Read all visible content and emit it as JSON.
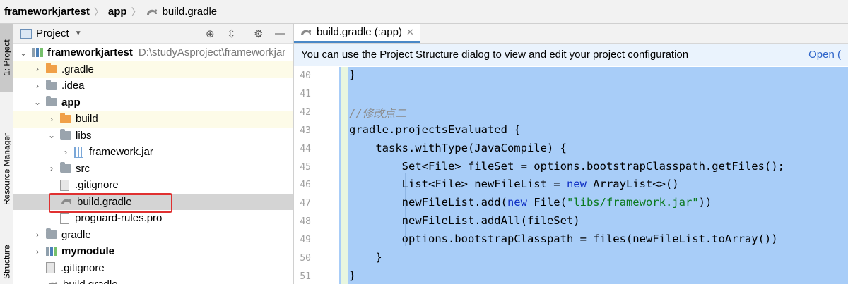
{
  "breadcrumb": {
    "items": [
      "frameworkjartest",
      "app",
      "build.gradle"
    ]
  },
  "tool_strip": {
    "project_tab": "1: Project",
    "resource_tab": "Resource Manager",
    "structure_tab": "Structure"
  },
  "project_panel": {
    "title": "Project",
    "tree": [
      {
        "label": "frameworkjartest",
        "path": "D:\\studyAsproject\\frameworkjar",
        "bold": true,
        "icon": "module-icon",
        "chevron": "expanded"
      },
      {
        "label": ".gradle",
        "icon": "folder-orange-icon",
        "chevron": "collapsed"
      },
      {
        "label": ".idea",
        "icon": "folder-icon",
        "chevron": "collapsed"
      },
      {
        "label": "app",
        "bold": true,
        "icon": "folder-icon",
        "chevron": "expanded"
      },
      {
        "label": "build",
        "icon": "folder-orange-icon",
        "chevron": "collapsed"
      },
      {
        "label": "libs",
        "icon": "folder-icon",
        "chevron": "expanded"
      },
      {
        "label": "framework.jar",
        "icon": "jar-icon",
        "chevron": "collapsed"
      },
      {
        "label": "src",
        "icon": "folder-icon",
        "chevron": "collapsed"
      },
      {
        "label": ".gitignore",
        "icon": "gitignore-icon",
        "chevron": "none"
      },
      {
        "label": "build.gradle",
        "icon": "gradle-icon",
        "chevron": "none"
      },
      {
        "label": "proguard-rules.pro",
        "icon": "file-icon",
        "chevron": "none"
      },
      {
        "label": "gradle",
        "icon": "folder-icon",
        "chevron": "collapsed"
      },
      {
        "label": "mymodule",
        "bold": true,
        "icon": "module-icon",
        "chevron": "collapsed"
      },
      {
        "label": ".gitignore",
        "icon": "gitignore-icon",
        "chevron": "none"
      },
      {
        "label": "build.gradle",
        "icon": "gradle-icon",
        "chevron": "none"
      }
    ]
  },
  "editor": {
    "tab_label": "build.gradle (:app)",
    "notice_text": "You can use the Project Structure dialog to view and edit your project configuration",
    "notice_link": "Open (",
    "line_numbers": [
      "40",
      "41",
      "42",
      "43",
      "44",
      "45",
      "46",
      "47",
      "48",
      "49",
      "50",
      "51"
    ],
    "lines": [
      "}",
      "",
      "//修改点二",
      "gradle.projectsEvaluated {",
      "    tasks.withType(JavaCompile) {",
      "        Set<File> fileSet = options.bootstrapClasspath.getFiles();",
      "        List<File> newFileList = new ArrayList<>()",
      "        newFileList.add(new File(\"libs/framework.jar\"))",
      "        newFileList.addAll(fileSet)",
      "        options.bootstrapClasspath = files(newFileList.toArray())",
      "    }",
      "}"
    ]
  },
  "colors": {
    "selection": "#a8cdf8",
    "highlight_border": "#e03030",
    "keyword": "#0f2fc4",
    "string": "#0b7a1f"
  }
}
